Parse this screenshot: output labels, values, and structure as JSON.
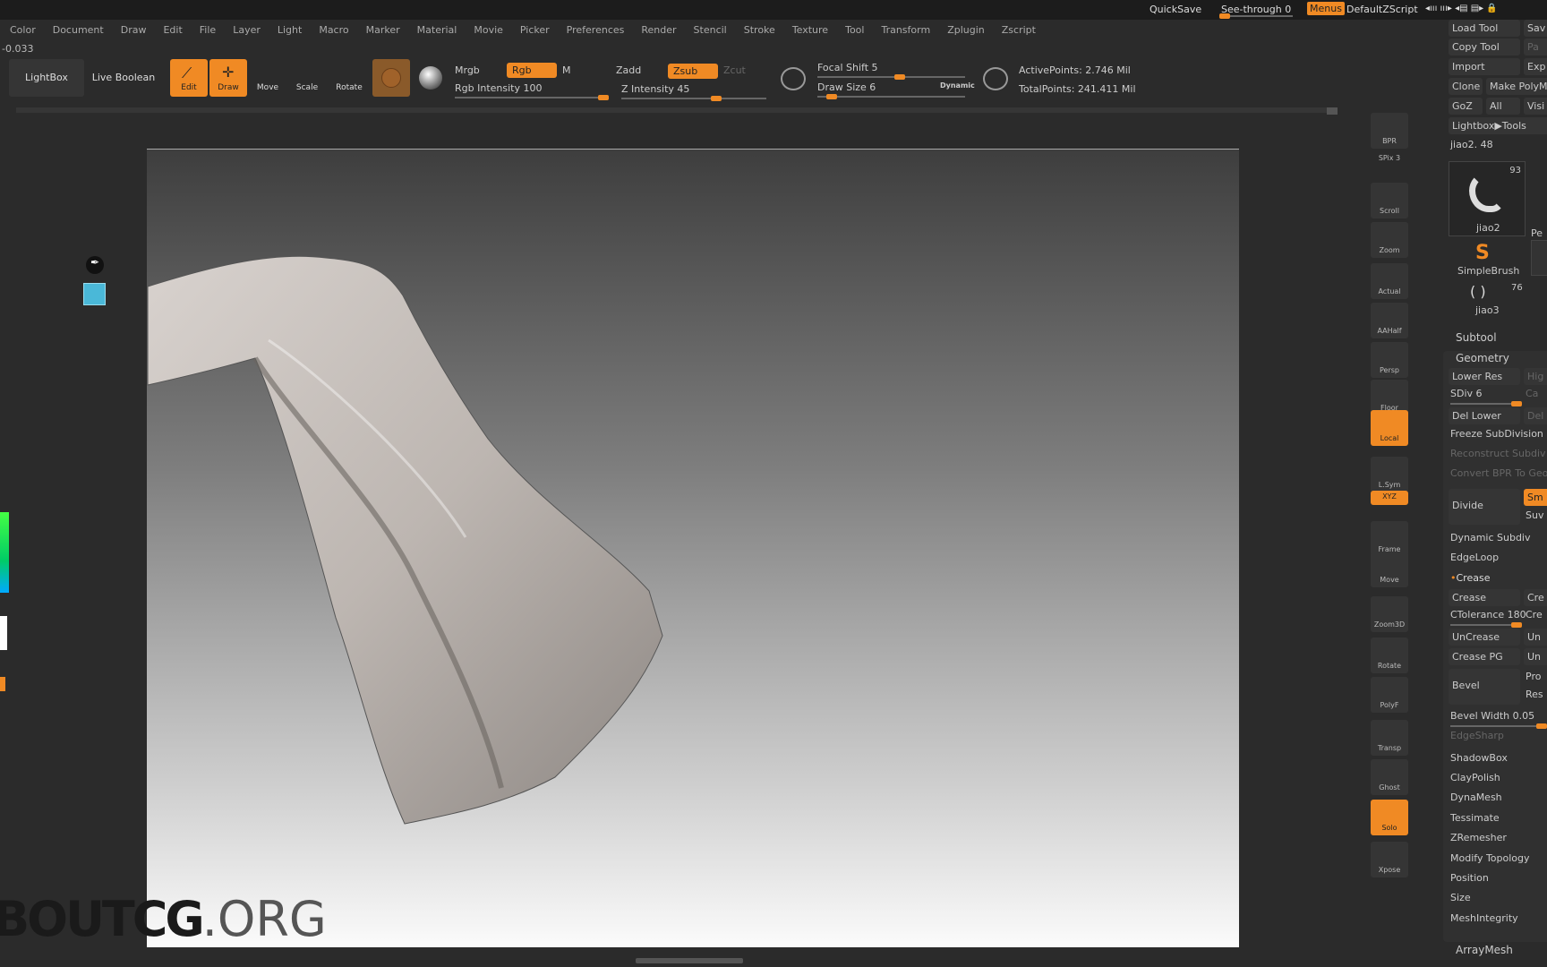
{
  "topbar": {
    "quicksave": "QuickSave",
    "see_through": "See-through  0",
    "menus": "Menus",
    "script": "DefaultZScript",
    "icons": "◂ııı ııı▸  ◂▤ ▤▸  🔒"
  },
  "menu": [
    "Color",
    "Document",
    "Draw",
    "Edit",
    "File",
    "Layer",
    "Light",
    "Macro",
    "Marker",
    "Material",
    "Movie",
    "Picker",
    "Preferences",
    "Render",
    "Stencil",
    "Stroke",
    "Texture",
    "Tool",
    "Transform",
    "Zplugin",
    "Zscript"
  ],
  "coordinate": "-0.033",
  "toolbar": {
    "lightbox": "LightBox",
    "live_boolean": "Live Boolean",
    "edit": "Edit",
    "draw": "Draw",
    "move": "Move",
    "scale": "Scale",
    "rotate": "Rotate",
    "mrgb": "Mrgb",
    "rgb": "Rgb",
    "m": "M",
    "rgb_intensity": "Rgb Intensity 100",
    "zadd": "Zadd",
    "zsub": "Zsub",
    "zcut": "Zcut",
    "z_intensity": "Z Intensity 45",
    "focal_shift": "Focal Shift 5",
    "draw_size": "Draw Size 6",
    "dynamic": "Dynamic",
    "active_points": "ActivePoints: 2.746 Mil",
    "total_points": "TotalPoints: 241.411 Mil",
    "rgb_intensity_value": 100,
    "z_intensity_value": 45,
    "focal_shift_value": 5,
    "draw_size_value": 6
  },
  "shelf": [
    {
      "label": "BPR"
    },
    {
      "label": "SPix 3"
    },
    {
      "label": "Scroll"
    },
    {
      "label": "Zoom"
    },
    {
      "label": "Actual"
    },
    {
      "label": "AAHalf"
    },
    {
      "label": "Persp"
    },
    {
      "label": "Floor"
    },
    {
      "label": "Local",
      "active": true
    },
    {
      "label": "L.Sym"
    },
    {
      "label": "XYZ",
      "active": true
    },
    {
      "label": "Frame"
    },
    {
      "label": "Move"
    },
    {
      "label": "Zoom3D"
    },
    {
      "label": "Rotate"
    },
    {
      "label": "PolyF"
    },
    {
      "label": "Transp"
    },
    {
      "label": "Ghost"
    },
    {
      "label": "Solo",
      "active": true
    },
    {
      "label": "Xpose"
    }
  ],
  "panel": {
    "load_tool": "Load Tool",
    "save": "Sav",
    "copy_tool": "Copy Tool",
    "paste": "Pa",
    "import": "Import",
    "export": "Exp",
    "clone": "Clone",
    "make_polymesh": "Make PolyM",
    "goz": "GoZ",
    "all": "All",
    "visible": "Visi",
    "lightbox_tools": "Lightbox▶Tools",
    "current_tool": "jiao2. 48",
    "tool1_name": "jiao2",
    "tool1_count": "93",
    "tool2_name": "SimpleBrush",
    "tool3_name": "jiao3",
    "tool3_count": "76",
    "tool4_name": "Pe",
    "subtool": "Subtool",
    "geometry": "Geometry",
    "lower_res": "Lower Res",
    "higher_res": "Hig",
    "sdiv": "SDiv 6",
    "cage": "Ca",
    "del_lower": "Del Lower",
    "del_higher": "Del",
    "freeze": "Freeze SubDivision L",
    "reconstruct": "Reconstruct Subdiv",
    "convert_bpr": "Convert BPR To Geo",
    "divide": "Divide",
    "smt": "Sm",
    "suv": "Suv",
    "dynamic_subdiv": "Dynamic Subdiv",
    "edgeloop": "EdgeLoop",
    "crease_section": "Crease",
    "crease": "Crease",
    "crease2": "Cre",
    "ctolerance": "CTolerance 180",
    "crease3": "Cre",
    "uncrease": "UnCrease",
    "uncrease2": "Un",
    "crease_pg": "Crease PG",
    "uncrease_pg": "Un",
    "bevel": "Bevel",
    "pro": "Pro",
    "res": "Res",
    "bevel_width": "Bevel Width 0.05",
    "edgesharp": "EdgeSharp",
    "shadowbox": "ShadowBox",
    "claypolish": "ClayPolish",
    "dynamesh": "DynaMesh",
    "tessimate": "Tessimate",
    "zremesher": "ZRemesher",
    "modify_topology": "Modify Topology",
    "position": "Position",
    "size": "Size",
    "meshintegrity": "MeshIntegrity",
    "arraymesh": "ArrayMesh"
  },
  "watermark": {
    "a": "BOUTCG",
    "b": ".ORG"
  },
  "colors": {
    "accent": "#f08a24",
    "background": "#2b2b2b"
  }
}
